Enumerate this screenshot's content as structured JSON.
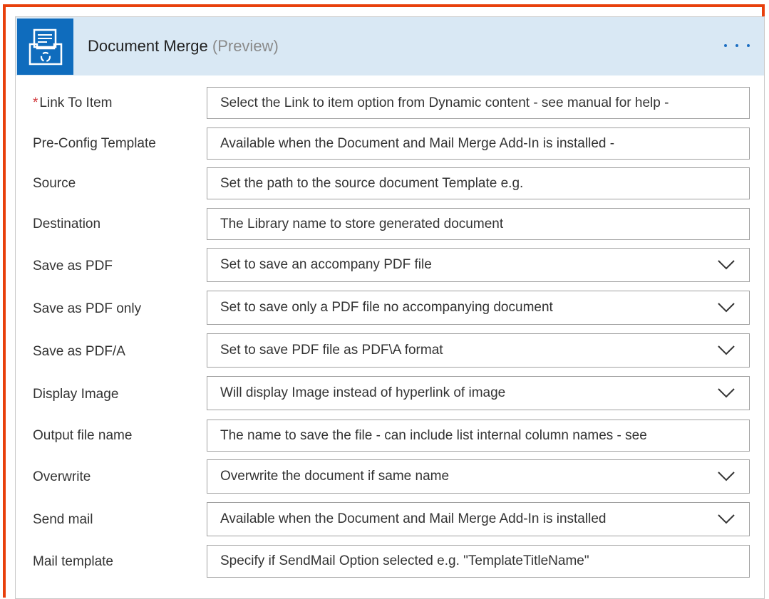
{
  "header": {
    "title": "Document Merge",
    "badge": "(Preview)",
    "icon": "document-merge-icon",
    "more_icon": "ellipsis-icon",
    "accent": "#0f6cbd",
    "header_bg": "#d9e8f4",
    "frame_color": "#e8400c"
  },
  "fields": [
    {
      "label": "Link To Item",
      "required": "*",
      "value": "Select the Link to item option from Dynamic content - see manual for help -",
      "type": "text"
    },
    {
      "label": "Pre-Config Template",
      "required": "",
      "value": "Available when the Document and Mail Merge Add-In is installed -",
      "type": "text"
    },
    {
      "label": "Source",
      "required": "",
      "value": "Set the path to the source document Template e.g.",
      "type": "text"
    },
    {
      "label": "Destination",
      "required": "",
      "value": "The Library name to store generated document",
      "type": "text"
    },
    {
      "label": "Save as PDF",
      "required": "",
      "value": "Set to save an accompany PDF file",
      "type": "dropdown"
    },
    {
      "label": "Save as PDF only",
      "required": "",
      "value": "Set to save only a PDF file no accompanying document",
      "type": "dropdown"
    },
    {
      "label": "Save as PDF/A",
      "required": "",
      "value": "Set to save PDF file as PDF\\A format",
      "type": "dropdown"
    },
    {
      "label": "Display Image",
      "required": "",
      "value": "Will display Image instead of hyperlink of image",
      "type": "dropdown"
    },
    {
      "label": "Output file name",
      "required": "",
      "value": "The name to save the file - can include list internal column names - see",
      "type": "text"
    },
    {
      "label": "Overwrite",
      "required": "",
      "value": "Overwrite the document if same name",
      "type": "dropdown"
    },
    {
      "label": "Send mail",
      "required": "",
      "value": "Available when the Document and Mail Merge Add-In is installed",
      "type": "dropdown"
    },
    {
      "label": "Mail template",
      "required": "",
      "value": "Specify if SendMail Option selected e.g. \"TemplateTitleName\"",
      "type": "text"
    }
  ]
}
